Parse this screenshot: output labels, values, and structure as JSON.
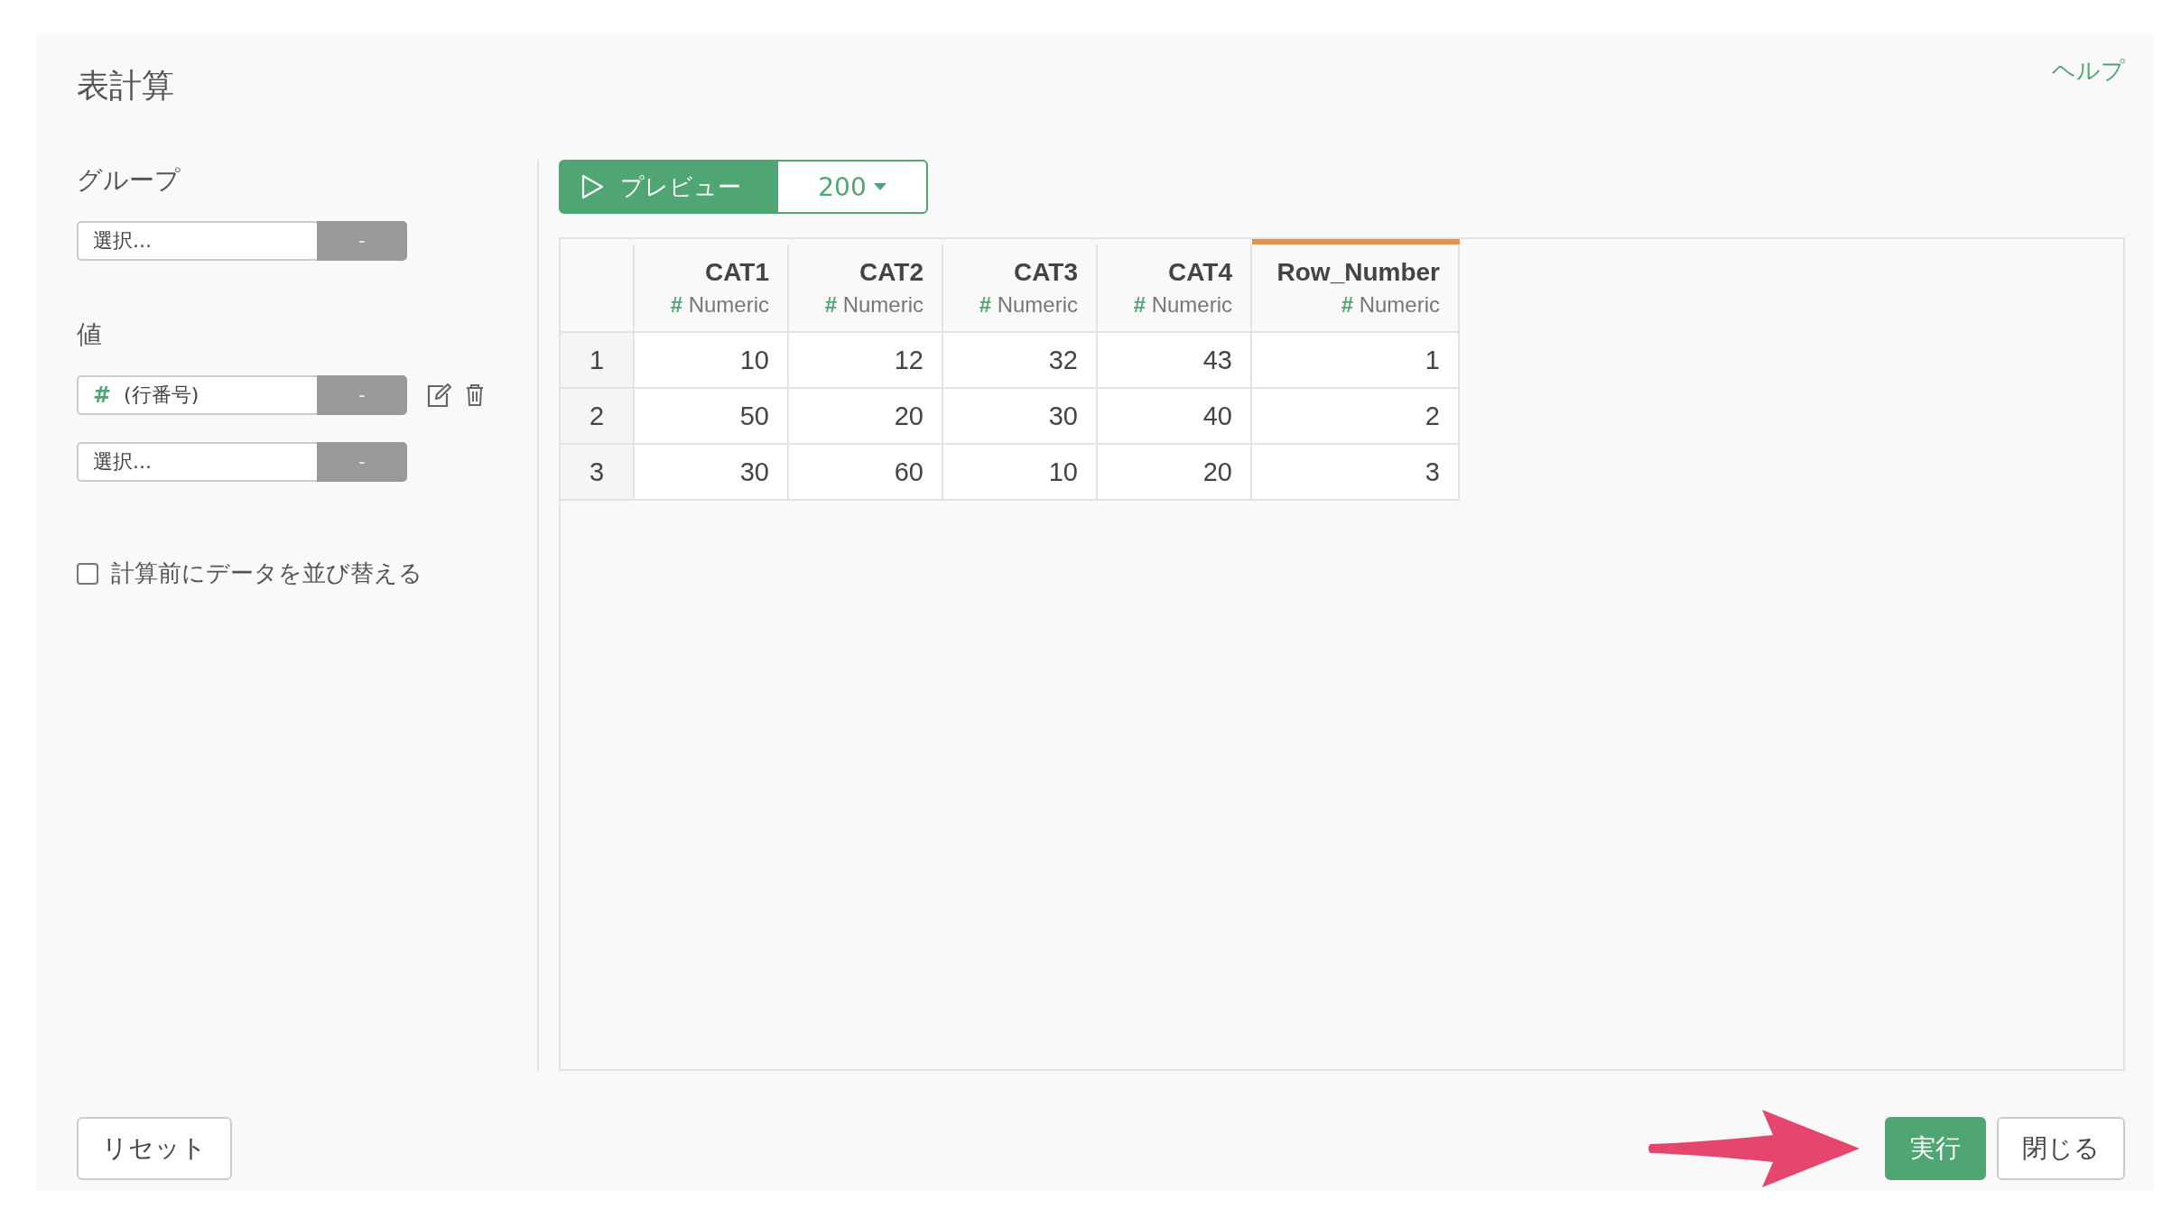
{
  "title": "表計算",
  "help_link": "ヘルプ",
  "group": {
    "label": "グループ",
    "fields": [
      {
        "placeholder": "選択...",
        "button": "-"
      }
    ]
  },
  "values": {
    "label": "値",
    "fields": [
      {
        "kind": "column",
        "type_icon": "#",
        "value": "(行番号)",
        "button": "-"
      },
      {
        "kind": "empty",
        "placeholder": "選択...",
        "button": "-"
      }
    ]
  },
  "sort_checkbox": {
    "label": "計算前にデータを並び替える",
    "checked": false
  },
  "preview": {
    "label": "プレビュー",
    "count": "200"
  },
  "table": {
    "columns": [
      {
        "name": "CAT1",
        "type_icon": "#",
        "type": "Numeric",
        "selected": false
      },
      {
        "name": "CAT2",
        "type_icon": "#",
        "type": "Numeric",
        "selected": false
      },
      {
        "name": "CAT3",
        "type_icon": "#",
        "type": "Numeric",
        "selected": false
      },
      {
        "name": "CAT4",
        "type_icon": "#",
        "type": "Numeric",
        "selected": false
      },
      {
        "name": "Row_Number",
        "type_icon": "#",
        "type": "Numeric",
        "selected": true
      }
    ],
    "rows": [
      {
        "index": "1",
        "cells": [
          "10",
          "12",
          "32",
          "43",
          "1"
        ]
      },
      {
        "index": "2",
        "cells": [
          "50",
          "20",
          "30",
          "40",
          "2"
        ]
      },
      {
        "index": "3",
        "cells": [
          "30",
          "60",
          "10",
          "20",
          "3"
        ]
      }
    ]
  },
  "buttons": {
    "reset": "リセット",
    "run": "実行",
    "close": "閉じる"
  }
}
